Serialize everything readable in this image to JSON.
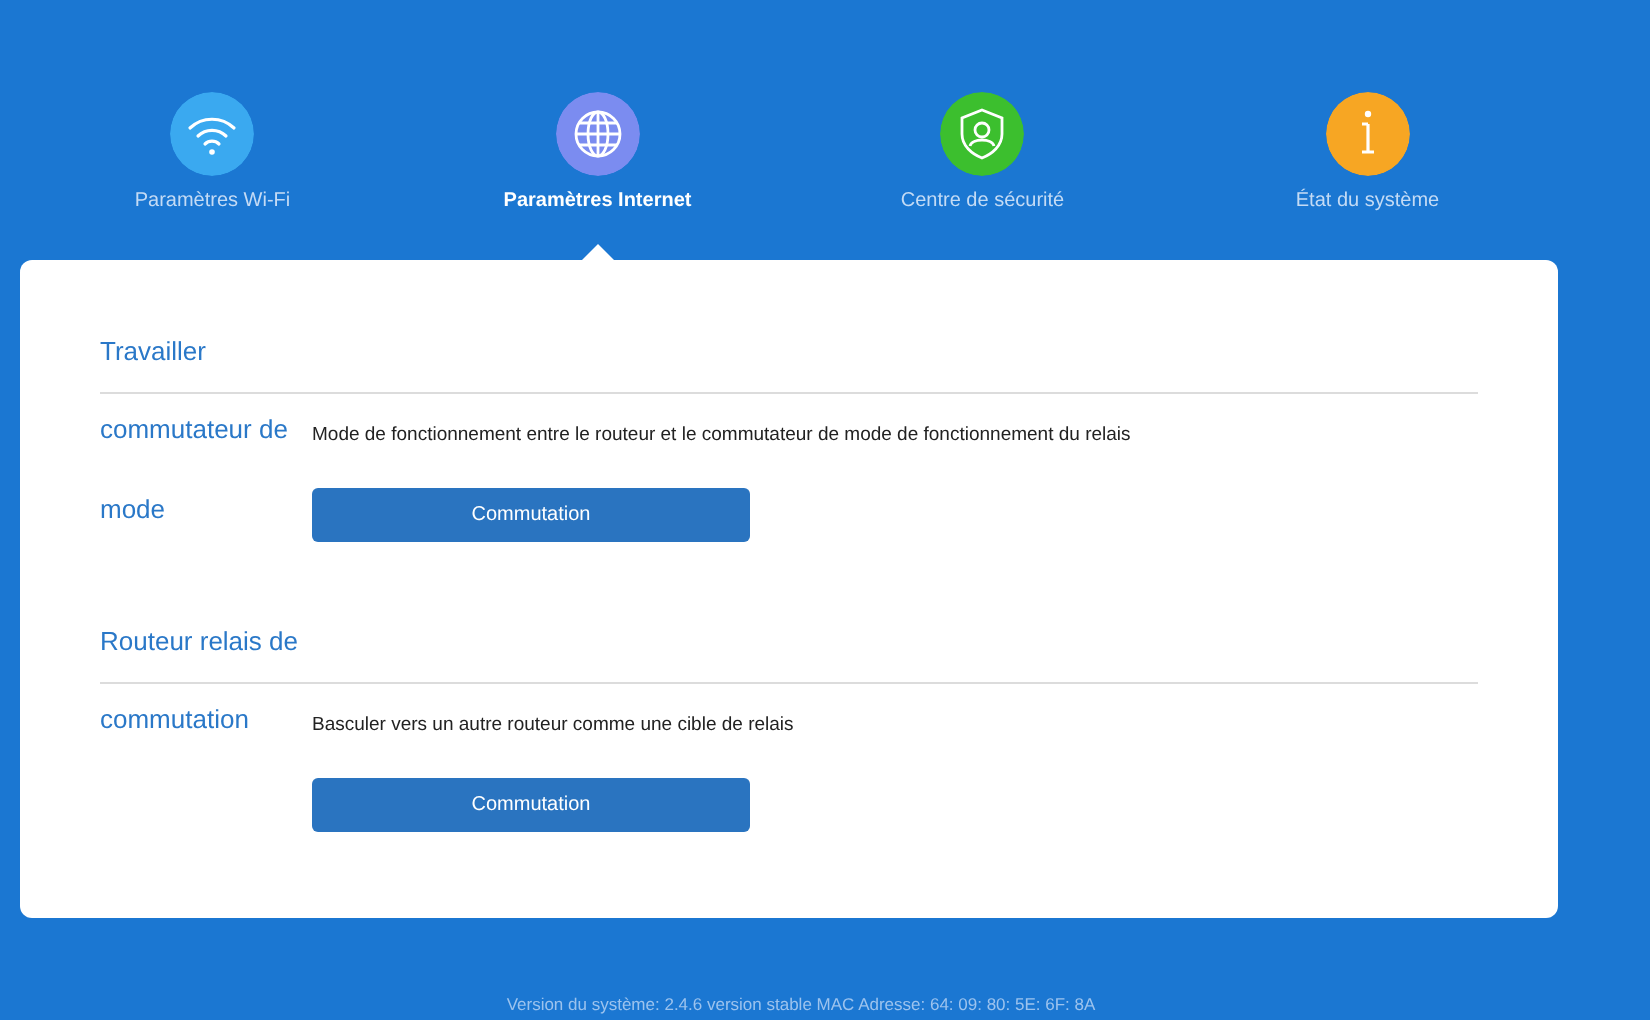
{
  "tabs": [
    {
      "label": "Paramètres Wi-Fi",
      "color": "#3aa9f0",
      "selected": false
    },
    {
      "label": "Paramètres Internet",
      "color": "#7b8cf0",
      "selected": true
    },
    {
      "label": "Centre de sécurité",
      "color": "#3cbf2e",
      "selected": false
    },
    {
      "label": "État du système",
      "color": "#f7a623",
      "selected": false
    }
  ],
  "sections": [
    {
      "heading": "Travailler",
      "label_lines": [
        "commutateur de",
        "mode"
      ],
      "description": "Mode de fonctionnement entre le routeur et le commutateur de mode de fonctionnement du relais",
      "button": "Commutation"
    },
    {
      "heading": "Routeur relais de",
      "label_lines": [
        "commutation"
      ],
      "description": "Basculer vers un autre routeur comme une cible de relais",
      "button": "Commutation"
    }
  ],
  "footer": "Version du système: 2.4.6 version stable MAC Adresse: 64: 09: 80: 5E: 6F: 8A"
}
